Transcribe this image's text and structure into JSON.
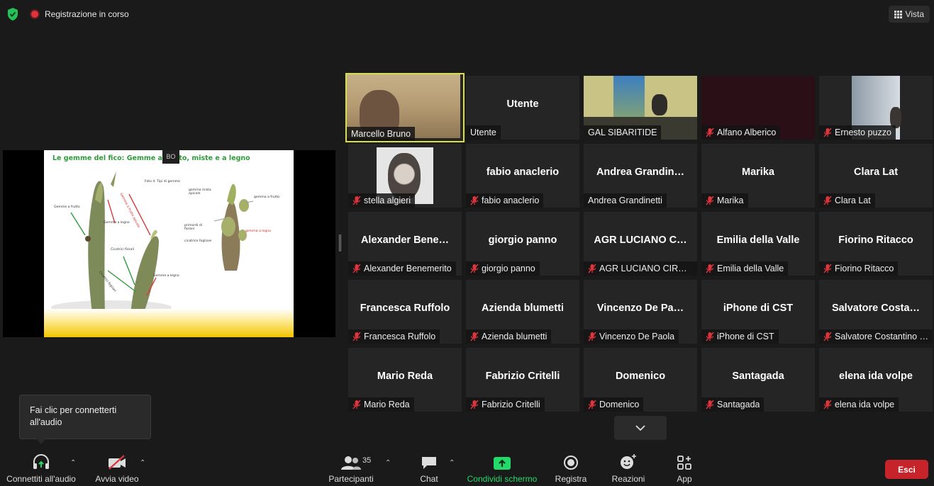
{
  "top_bar": {
    "recording_text": "Registrazione in corso",
    "view_label": "Vista"
  },
  "shared_screen": {
    "badge_text": "BO",
    "slide": {
      "title": "Le gemme del fico:  Gemme a frutto, miste e a legno",
      "labels": {
        "foto": "Foto 4.   Tipi di gemme",
        "gemme_frutto_left": "Gemme a frutto",
        "gemme_frutto_top": "Gemme a frutto apicale",
        "gemme_legno": "Gemme a legno",
        "cicatrici": "Cicatrici fiorali",
        "cicatrici_fogliari": "Cicatrici fogliari",
        "gemme_legno_low": "Gemme a legno",
        "gemma_mista": "gemma mista apicale",
        "gemma_frutto_right": "gemma a frutto",
        "primordi": "primordi di fioroni",
        "gemma_legno_right": "gemma a legno",
        "cicatrice_fogliare": "cicatrice fogliare"
      }
    }
  },
  "participants": [
    {
      "name": "Marcello Bruno",
      "label": "Marcello Bruno",
      "muted": false,
      "video": true,
      "active": true
    },
    {
      "name": "Utente",
      "label": "Utente",
      "muted": false,
      "video": false,
      "active": false
    },
    {
      "name": "GAL SIBARITIDE",
      "label": "GAL SIBARITIDE",
      "muted": false,
      "video": true,
      "active": false
    },
    {
      "name": "Alfano Alberico",
      "label": "Alfano Alberico",
      "muted": true,
      "video": true,
      "active": false
    },
    {
      "name": "Ernesto puzzo",
      "label": "Ernesto puzzo",
      "muted": true,
      "video": true,
      "active": false
    },
    {
      "name": "stella algieri",
      "label": "stella algieri",
      "muted": true,
      "video": true,
      "active": false
    },
    {
      "name": "fabio anaclerio",
      "label": "fabio anaclerio",
      "muted": true,
      "video": false,
      "active": false
    },
    {
      "name": "Andrea  Grandin…",
      "label": "Andrea Grandinetti",
      "muted": false,
      "video": false,
      "active": false
    },
    {
      "name": "Marika",
      "label": "Marika",
      "muted": true,
      "video": false,
      "active": false
    },
    {
      "name": "Clara Lat",
      "label": "Clara Lat",
      "muted": true,
      "video": false,
      "active": false
    },
    {
      "name": "Alexander  Bene…",
      "label": "Alexander Benemerito",
      "muted": true,
      "video": false,
      "active": false
    },
    {
      "name": "giorgio panno",
      "label": "giorgio panno",
      "muted": true,
      "video": false,
      "active": false
    },
    {
      "name": "AGR LUCIANO C…",
      "label": "AGR LUCIANO CIROL…",
      "muted": true,
      "video": false,
      "active": false
    },
    {
      "name": "Emilia della Valle",
      "label": "Emilia della Valle",
      "muted": true,
      "video": false,
      "active": false
    },
    {
      "name": "Fiorino Ritacco",
      "label": "Fiorino Ritacco",
      "muted": true,
      "video": false,
      "active": false
    },
    {
      "name": "Francesca Ruffolo",
      "label": "Francesca Ruffolo",
      "muted": true,
      "video": false,
      "active": false
    },
    {
      "name": "Azienda blumetti",
      "label": "Azienda blumetti",
      "muted": true,
      "video": false,
      "active": false
    },
    {
      "name": "Vincenzo  De  Pa…",
      "label": "Vincenzo De Paola",
      "muted": true,
      "video": false,
      "active": false
    },
    {
      "name": "iPhone di CST",
      "label": "iPhone di CST",
      "muted": true,
      "video": false,
      "active": false
    },
    {
      "name": "Salvatore  Costa…",
      "label": "Salvatore Costantino …",
      "muted": true,
      "video": false,
      "active": false
    },
    {
      "name": "Mario Reda",
      "label": "Mario Reda",
      "muted": true,
      "video": false,
      "active": false
    },
    {
      "name": "Fabrizio Critelli",
      "label": "Fabrizio Critelli",
      "muted": true,
      "video": false,
      "active": false
    },
    {
      "name": "Domenico",
      "label": "Domenico",
      "muted": true,
      "video": false,
      "active": false
    },
    {
      "name": "Santagada",
      "label": "Santagada",
      "muted": true,
      "video": false,
      "active": false
    },
    {
      "name": "elena ida volpe",
      "label": "elena ida volpe",
      "muted": true,
      "video": false,
      "active": false
    }
  ],
  "tooltip": {
    "text": "Fai clic per connetterti all'audio"
  },
  "toolbar": {
    "audio_label": "Connettiti all'audio",
    "video_label": "Avvia video",
    "participants_label": "Partecipanti",
    "participants_count": "35",
    "chat_label": "Chat",
    "share_label": "Condividi schermo",
    "record_label": "Registra",
    "reactions_label": "Reazioni",
    "apps_label": "App",
    "leave_label": "Esci"
  },
  "colors": {
    "background": "#1a1a1a",
    "tile": "#252525",
    "active_speaker": "#d8e13d",
    "share_green": "#23d96a",
    "leave_red": "#c7232b",
    "muted_red": "#e0343c"
  }
}
